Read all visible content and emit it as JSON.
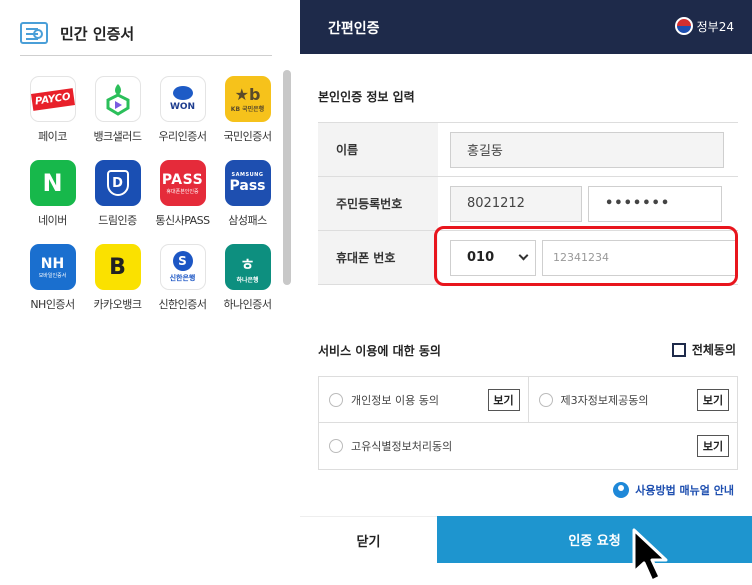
{
  "left_panel": {
    "title": "민간 인증서",
    "providers": [
      {
        "label": "페이코",
        "logo_text": "PAYCO"
      },
      {
        "label": "뱅크샐러드",
        "logo_text": ""
      },
      {
        "label": "우리인증서",
        "logo_text": "WON"
      },
      {
        "label": "국민인증서",
        "logo_text": "KB 국민은행"
      },
      {
        "label": "네이버",
        "logo_text": "N"
      },
      {
        "label": "드림인증",
        "logo_text": "D"
      },
      {
        "label": "통신사PASS",
        "logo_text": "PASS"
      },
      {
        "label": "삼성패스",
        "logo_text": "Pass"
      },
      {
        "label": "NH인증서",
        "logo_text": "NH"
      },
      {
        "label": "카카오뱅크",
        "logo_text": "B"
      },
      {
        "label": "신한인증서",
        "logo_text": "신한은행"
      },
      {
        "label": "하나인증서",
        "logo_text": "하나은행"
      }
    ],
    "logo_subtexts": {
      "kb_mark": "★b",
      "pass_sub": "휴대폰본인인증",
      "samsung_sub": "SAMSUNG",
      "nh_sub": "모바일인증서",
      "shinhan_mark": "S",
      "hana_mark": "ㅎ"
    }
  },
  "right_panel": {
    "header_title": "간편인증",
    "gov_label": "정부24",
    "section_title": "본인인증 정보 입력",
    "form": {
      "name_label": "이름",
      "name_value": "홍길동",
      "rrn_label": "주민등록번호",
      "rrn_front": "8021212",
      "rrn_back": "•••••••",
      "phone_label": "휴대폰 번호",
      "carrier_value": "010",
      "phone_placeholder": "12341234"
    },
    "agreement": {
      "title": "서비스 이용에 대한 동의",
      "agree_all": "전체동의",
      "items": [
        {
          "label": "개인정보 이용 동의",
          "button": "보기"
        },
        {
          "label": "제3자정보제공동의",
          "button": "보기"
        },
        {
          "label": "고유식별정보처리동의",
          "button": "보기"
        }
      ]
    },
    "manual_link": "사용방법 매뉴얼 안내",
    "close_button": "닫기",
    "submit_button": "인증 요청"
  },
  "colors": {
    "header_bg": "#1e2a4a",
    "submit_bg": "#1e95cf",
    "highlight": "#e8151d"
  }
}
